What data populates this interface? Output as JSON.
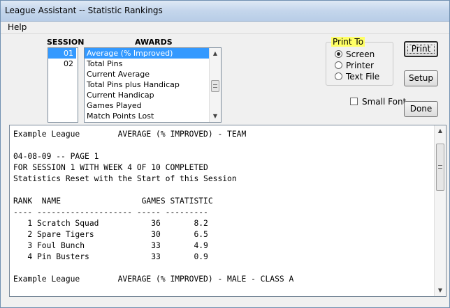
{
  "window": {
    "title": "League Assistant -- Statistic Rankings"
  },
  "menu": {
    "help": "Help"
  },
  "session": {
    "header": "SESSION",
    "items": [
      "01",
      "02"
    ],
    "selected": 0
  },
  "awards": {
    "header": "AWARDS",
    "items": [
      "Average (% Improved)",
      "Total Pins",
      "Current Average",
      "Total Pins plus Handicap",
      "Current Handicap",
      "Games Played",
      "Match Points Lost"
    ],
    "selected": 0
  },
  "print_to": {
    "legend": "Print To",
    "options": [
      "Screen",
      "Printer",
      "Text File"
    ],
    "selected": 0
  },
  "buttons": {
    "print": "Print",
    "setup": "Setup",
    "done": "Done"
  },
  "small_font": {
    "label": "Small Font",
    "checked": false
  },
  "report": {
    "lines": [
      "Example League        AVERAGE (% IMPROVED) - TEAM",
      "",
      "04-08-09 -- PAGE 1",
      "FOR SESSION 1 WITH WEEK 4 OF 10 COMPLETED",
      "Statistics Reset with the Start of this Session",
      "",
      "RANK  NAME                 GAMES STATISTIC",
      "---- -------------------- ----- ---------",
      "   1 Scratch Squad           36       8.2",
      "   2 Spare Tigers            30       6.5",
      "   3 Foul Bunch              33       4.9",
      "   4 Pin Busters             33       0.9",
      "",
      "Example League        AVERAGE (% IMPROVED) - MALE - CLASS A"
    ]
  },
  "icons": {
    "scroll_up": "▲",
    "scroll_down": "▼"
  }
}
